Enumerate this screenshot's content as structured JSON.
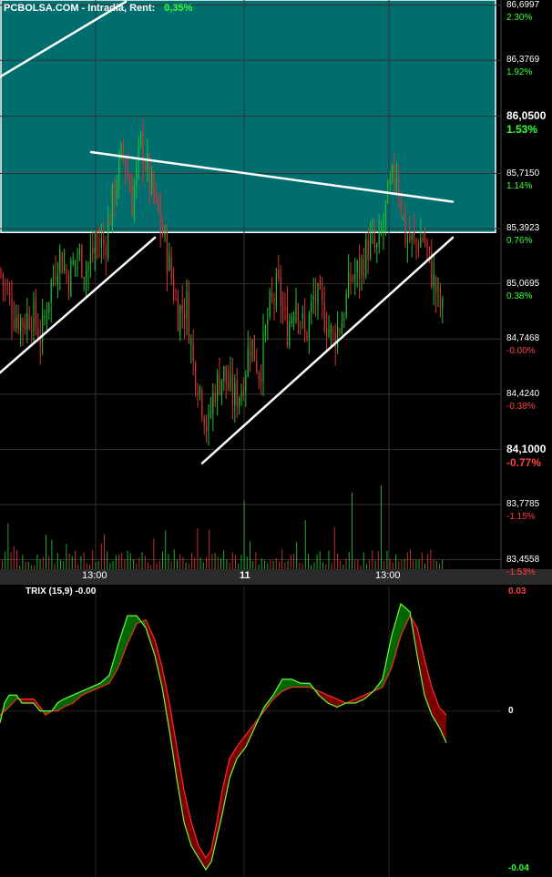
{
  "header": {
    "title": "PCBOLSA.COM - Intradía, Rent:",
    "return_value": "0,35%"
  },
  "colors": {
    "up": "#1fbf2f",
    "down": "#d43434",
    "pct_up": "#33ff33",
    "pct_down": "#ff4040",
    "highlight_box": "#006e6e",
    "trend_line": "#ffffff",
    "grid": "#333333",
    "trix_green": "#006600",
    "trix_red": "#7a0000"
  },
  "chart_data": [
    {
      "type": "candlestick",
      "y_axis": [
        {
          "price": "86,6997",
          "pct": "2.30%",
          "value": 86.6997,
          "dir": "up",
          "bold": false
        },
        {
          "price": "86,3769",
          "pct": "1.92%",
          "value": 86.3769,
          "dir": "up",
          "bold": false
        },
        {
          "price": "86,0500",
          "pct": "1.53%",
          "value": 86.05,
          "dir": "up",
          "bold": true
        },
        {
          "price": "85,7150",
          "pct": "1.14%",
          "value": 85.715,
          "dir": "up",
          "bold": false
        },
        {
          "price": "85,3923",
          "pct": "0.76%",
          "value": 85.3923,
          "dir": "up",
          "bold": false
        },
        {
          "price": "85,0695",
          "pct": "0.38%",
          "value": 85.0695,
          "dir": "up",
          "bold": false
        },
        {
          "price": "84,7468",
          "pct": "-0.00%",
          "value": 84.7468,
          "dir": "down",
          "bold": false
        },
        {
          "price": "84,4240",
          "pct": "-0.38%",
          "value": 84.424,
          "dir": "down",
          "bold": false
        },
        {
          "price": "84,1000",
          "pct": "-0.77%",
          "value": 84.1,
          "dir": "down",
          "bold": true
        },
        {
          "price": "83,7785",
          "pct": "-1.15%",
          "value": 83.7785,
          "dir": "down",
          "bold": false
        },
        {
          "price": "83,4558",
          "pct": "-1.53%",
          "value": 83.4558,
          "dir": "down",
          "bold": false
        }
      ],
      "x_ticks": [
        {
          "label": "13:00",
          "bold": false
        },
        {
          "label": "11",
          "bold": true
        },
        {
          "label": "13:00",
          "bold": false
        }
      ],
      "price_path": [
        [
          0,
          85.15
        ],
        [
          8,
          85.0
        ],
        [
          15,
          84.9
        ],
        [
          25,
          84.85
        ],
        [
          35,
          84.9
        ],
        [
          45,
          84.75
        ],
        [
          55,
          85.05
        ],
        [
          65,
          85.25
        ],
        [
          75,
          85.1
        ],
        [
          85,
          85.25
        ],
        [
          95,
          85.15
        ],
        [
          105,
          85.3
        ],
        [
          115,
          85.3
        ],
        [
          125,
          85.6
        ],
        [
          135,
          85.85
        ],
        [
          145,
          85.55
        ],
        [
          155,
          85.9
        ],
        [
          165,
          85.65
        ],
        [
          175,
          85.45
        ],
        [
          185,
          85.2
        ],
        [
          195,
          84.9
        ],
        [
          205,
          84.95
        ],
        [
          212,
          84.6
        ],
        [
          220,
          84.45
        ],
        [
          228,
          84.2
        ],
        [
          235,
          84.45
        ],
        [
          245,
          84.55
        ],
        [
          255,
          84.4
        ],
        [
          265,
          84.45
        ],
        [
          275,
          84.75
        ],
        [
          285,
          84.55
        ],
        [
          295,
          84.9
        ],
        [
          305,
          85.05
        ],
        [
          315,
          84.8
        ],
        [
          325,
          85.0
        ],
        [
          335,
          84.75
        ],
        [
          345,
          85.0
        ],
        [
          355,
          84.9
        ],
        [
          365,
          84.75
        ],
        [
          375,
          84.85
        ],
        [
          385,
          85.1
        ],
        [
          395,
          85.15
        ],
        [
          405,
          85.3
        ],
        [
          415,
          85.25
        ],
        [
          425,
          85.55
        ],
        [
          435,
          85.75
        ],
        [
          445,
          85.35
        ],
        [
          455,
          85.3
        ],
        [
          465,
          85.35
        ],
        [
          475,
          85.1
        ],
        [
          485,
          84.9
        ]
      ],
      "trend_lines": [
        {
          "points": [
            [
              0,
              86.28
            ],
            [
              138,
              86.72
            ]
          ]
        },
        {
          "points": [
            [
              100,
              85.84
            ],
            [
              497,
              85.55
            ]
          ]
        },
        {
          "points": [
            [
              0,
              84.55
            ],
            [
              170,
              85.34
            ]
          ]
        },
        {
          "points": [
            [
              222,
              84.02
            ],
            [
              497,
              85.34
            ]
          ]
        }
      ],
      "highlight_region": {
        "x": [
          0,
          545
        ],
        "y": [
          85.37,
          86.73
        ]
      }
    },
    {
      "type": "area",
      "title": "TRIX (15,9) -0.00",
      "y_labels": [
        {
          "label": "0.03",
          "value": 0.03,
          "color": "#ff4040"
        },
        {
          "label": "0",
          "value": 0,
          "color": "#ffffff"
        },
        {
          "label": "-0.04",
          "value": -0.04,
          "color": "#33ff33"
        }
      ],
      "ylim": [
        -0.04,
        0.03
      ],
      "trix": [
        [
          0,
          -0.003
        ],
        [
          5,
          0.002
        ],
        [
          10,
          0.004
        ],
        [
          18,
          0.004
        ],
        [
          24,
          0.002
        ],
        [
          30,
          0.002
        ],
        [
          37,
          0.002
        ],
        [
          44,
          0.0
        ],
        [
          50,
          0.0
        ],
        [
          57,
          0.0
        ],
        [
          63,
          0.002
        ],
        [
          70,
          0.003
        ],
        [
          80,
          0.004
        ],
        [
          90,
          0.005
        ],
        [
          100,
          0.006
        ],
        [
          110,
          0.007
        ],
        [
          120,
          0.009
        ],
        [
          130,
          0.017
        ],
        [
          140,
          0.024
        ],
        [
          150,
          0.024
        ],
        [
          160,
          0.021
        ],
        [
          170,
          0.014
        ],
        [
          178,
          0.006
        ],
        [
          186,
          -0.005
        ],
        [
          194,
          -0.017
        ],
        [
          202,
          -0.028
        ],
        [
          210,
          -0.034
        ],
        [
          218,
          -0.037
        ],
        [
          226,
          -0.04
        ],
        [
          232,
          -0.038
        ],
        [
          238,
          -0.032
        ],
        [
          244,
          -0.026
        ],
        [
          252,
          -0.017
        ],
        [
          260,
          -0.012
        ],
        [
          270,
          -0.009
        ],
        [
          280,
          -0.004
        ],
        [
          290,
          0.001
        ],
        [
          300,
          0.004
        ],
        [
          310,
          0.008
        ],
        [
          320,
          0.008
        ],
        [
          330,
          0.007
        ],
        [
          340,
          0.007
        ],
        [
          350,
          0.004
        ],
        [
          360,
          0.002
        ],
        [
          370,
          0.001
        ],
        [
          380,
          0.002
        ],
        [
          390,
          0.002
        ],
        [
          400,
          0.003
        ],
        [
          410,
          0.005
        ],
        [
          420,
          0.008
        ],
        [
          430,
          0.019
        ],
        [
          440,
          0.027
        ],
        [
          450,
          0.025
        ],
        [
          458,
          0.014
        ],
        [
          466,
          0.004
        ],
        [
          474,
          -0.001
        ],
        [
          482,
          -0.004
        ],
        [
          490,
          -0.008
        ]
      ],
      "signal": [
        [
          0,
          -0.001
        ],
        [
          5,
          0.0
        ],
        [
          10,
          0.001
        ],
        [
          18,
          0.003
        ],
        [
          24,
          0.003
        ],
        [
          30,
          0.003
        ],
        [
          37,
          0.003
        ],
        [
          44,
          0.001
        ],
        [
          50,
          -0.001
        ],
        [
          57,
          0.0
        ],
        [
          63,
          0.0
        ],
        [
          70,
          0.001
        ],
        [
          80,
          0.002
        ],
        [
          90,
          0.004
        ],
        [
          100,
          0.005
        ],
        [
          110,
          0.006
        ],
        [
          120,
          0.007
        ],
        [
          130,
          0.011
        ],
        [
          140,
          0.017
        ],
        [
          150,
          0.022
        ],
        [
          160,
          0.023
        ],
        [
          170,
          0.018
        ],
        [
          178,
          0.011
        ],
        [
          186,
          0.002
        ],
        [
          194,
          -0.009
        ],
        [
          202,
          -0.02
        ],
        [
          210,
          -0.028
        ],
        [
          218,
          -0.034
        ],
        [
          226,
          -0.037
        ],
        [
          232,
          -0.035
        ],
        [
          238,
          -0.028
        ],
        [
          244,
          -0.02
        ],
        [
          252,
          -0.012
        ],
        [
          260,
          -0.009
        ],
        [
          270,
          -0.006
        ],
        [
          280,
          -0.003
        ],
        [
          290,
          0.0
        ],
        [
          300,
          0.003
        ],
        [
          310,
          0.005
        ],
        [
          320,
          0.006
        ],
        [
          330,
          0.006
        ],
        [
          340,
          0.006
        ],
        [
          350,
          0.005
        ],
        [
          360,
          0.004
        ],
        [
          370,
          0.003
        ],
        [
          380,
          0.002
        ],
        [
          390,
          0.003
        ],
        [
          400,
          0.004
        ],
        [
          410,
          0.005
        ],
        [
          420,
          0.006
        ],
        [
          430,
          0.011
        ],
        [
          440,
          0.019
        ],
        [
          450,
          0.024
        ],
        [
          458,
          0.021
        ],
        [
          466,
          0.013
        ],
        [
          474,
          0.006
        ],
        [
          482,
          0.001
        ],
        [
          490,
          -0.001
        ]
      ]
    }
  ]
}
